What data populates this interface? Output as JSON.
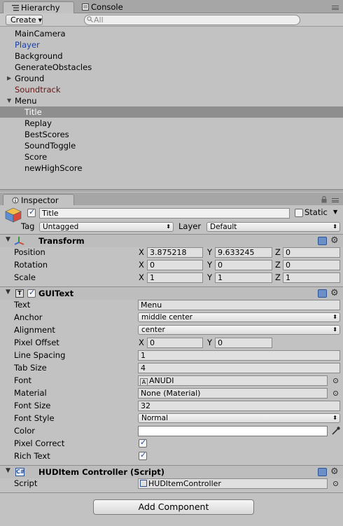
{
  "hierarchy_panel": {
    "tabs": [
      {
        "label": "Hierarchy",
        "active": true,
        "icon": "list-icon"
      },
      {
        "label": "Console",
        "active": false,
        "icon": "console-icon"
      }
    ],
    "create_label": "Create",
    "search_placeholder": "All",
    "items": [
      {
        "label": "MainCamera",
        "style": "normal",
        "arrow": ""
      },
      {
        "label": "Player",
        "style": "blue",
        "arrow": ""
      },
      {
        "label": "Background",
        "style": "normal",
        "arrow": ""
      },
      {
        "label": "GenerateObstacles",
        "style": "normal",
        "arrow": ""
      },
      {
        "label": "Ground",
        "style": "normal",
        "arrow": "▶"
      },
      {
        "label": "Soundtrack",
        "style": "red",
        "arrow": ""
      },
      {
        "label": "Menu",
        "style": "normal",
        "arrow": "▼"
      },
      {
        "label": "Title",
        "style": "selected",
        "arrow": "",
        "child": true
      },
      {
        "label": "Replay",
        "style": "normal",
        "arrow": "",
        "child": true
      },
      {
        "label": "BestScores",
        "style": "normal",
        "arrow": "",
        "child": true
      },
      {
        "label": "SoundToggle",
        "style": "normal",
        "arrow": "",
        "child": true
      },
      {
        "label": "Score",
        "style": "normal",
        "arrow": "",
        "child": true
      },
      {
        "label": "newHighScore",
        "style": "normal",
        "arrow": "",
        "child": true
      }
    ]
  },
  "inspector": {
    "tab_label": "Inspector",
    "object_name": "Title",
    "static_label": "Static",
    "tag_label": "Tag",
    "tag_value": "Untagged",
    "layer_label": "Layer",
    "layer_value": "Default",
    "transform": {
      "title": "Transform",
      "rows": [
        {
          "label": "Position",
          "x": "3.875218",
          "y": "9.633245",
          "z": "0"
        },
        {
          "label": "Rotation",
          "x": "0",
          "y": "0",
          "z": "0"
        },
        {
          "label": "Scale",
          "x": "1",
          "y": "1",
          "z": "1"
        }
      ]
    },
    "guitext": {
      "title": "GUIText",
      "text_label": "Text",
      "text_value": "Menu",
      "anchor_label": "Anchor",
      "anchor_value": "middle center",
      "alignment_label": "Alignment",
      "alignment_value": "center",
      "pixel_offset_label": "Pixel Offset",
      "pixel_offset_x": "0",
      "pixel_offset_y": "0",
      "line_spacing_label": "Line Spacing",
      "line_spacing_value": "1",
      "tab_size_label": "Tab Size",
      "tab_size_value": "4",
      "font_label": "Font",
      "font_value": "ANUDI",
      "material_label": "Material",
      "material_value": "None (Material)",
      "font_size_label": "Font Size",
      "font_size_value": "32",
      "font_style_label": "Font Style",
      "font_style_value": "Normal",
      "color_label": "Color",
      "color_value": "#ffffff",
      "pixel_correct_label": "Pixel Correct",
      "pixel_correct": true,
      "rich_text_label": "Rich Text",
      "rich_text": true
    },
    "script_component": {
      "title": "HUDItem Controller (Script)",
      "script_label": "Script",
      "script_value": "HUDItemController"
    },
    "add_component_label": "Add Component"
  },
  "axis_letters": {
    "x": "X",
    "y": "Y",
    "z": "Z"
  }
}
